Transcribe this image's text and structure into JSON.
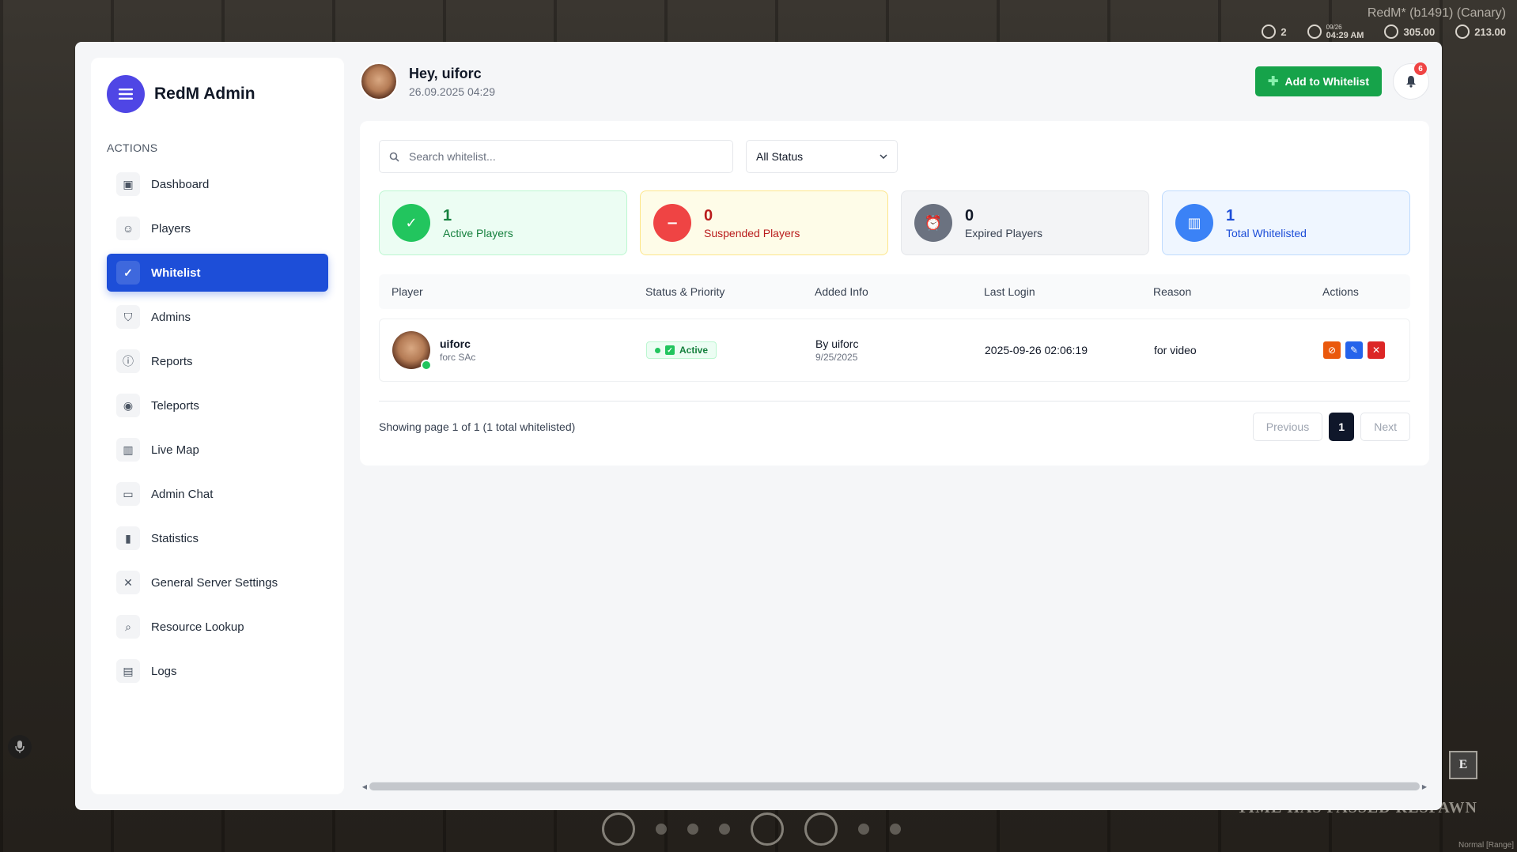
{
  "game_hud": {
    "build": "RedM* (b1491) (Canary)",
    "stats": [
      {
        "icon": "horse-icon",
        "value": "2"
      },
      {
        "icon": "clock-icon",
        "date": "09/26",
        "value": "04:29 AM"
      },
      {
        "icon": "dollar-icon",
        "value": "305.00"
      },
      {
        "icon": "gold-icon",
        "value": "213.00"
      }
    ],
    "respawn_text": "TIME HAS PASSED RESPAWN",
    "key_hint": "E",
    "mode": "Normal [Range]"
  },
  "sidebar": {
    "brand": "RedM Admin",
    "section_label": "ACTIONS",
    "items": [
      {
        "label": "Dashboard",
        "icon": "dashboard-icon",
        "active": false
      },
      {
        "label": "Players",
        "icon": "players-icon",
        "active": false
      },
      {
        "label": "Whitelist",
        "icon": "check-circle-icon",
        "active": true
      },
      {
        "label": "Admins",
        "icon": "shield-icon",
        "active": false
      },
      {
        "label": "Reports",
        "icon": "alert-circle-icon",
        "active": false
      },
      {
        "label": "Teleports",
        "icon": "map-pin-icon",
        "active": false
      },
      {
        "label": "Live Map",
        "icon": "map-icon",
        "active": false
      },
      {
        "label": "Admin Chat",
        "icon": "chat-icon",
        "active": false
      },
      {
        "label": "Statistics",
        "icon": "bar-chart-icon",
        "active": false
      },
      {
        "label": "General Server Settings",
        "icon": "tools-icon",
        "active": false
      },
      {
        "label": "Resource Lookup",
        "icon": "search-icon",
        "active": false
      },
      {
        "label": "Logs",
        "icon": "logs-icon",
        "active": false
      }
    ]
  },
  "header": {
    "greeting": "Hey, uiforc",
    "datetime": "26.09.2025 04:29",
    "add_button": "Add to Whitelist",
    "notifications_count": "6"
  },
  "filters": {
    "search_placeholder": "Search whitelist...",
    "status_selected": "All Status"
  },
  "stats": [
    {
      "value": "1",
      "label": "Active Players"
    },
    {
      "value": "0",
      "label": "Suspended Players"
    },
    {
      "value": "0",
      "label": "Expired Players"
    },
    {
      "value": "1",
      "label": "Total Whitelisted"
    }
  ],
  "table": {
    "columns": [
      "Player",
      "Status & Priority",
      "Added Info",
      "Last Login",
      "Reason",
      "Actions"
    ],
    "rows": [
      {
        "name": "uiforc",
        "sub": "forc SAc",
        "status": "Active",
        "added_by": "By uiforc",
        "added_date": "9/25/2025",
        "last_login": "2025-09-26 02:06:19",
        "reason": "for video"
      }
    ]
  },
  "pagination": {
    "info": "Showing page 1 of 1 (1 total whitelisted)",
    "previous": "Previous",
    "current": "1",
    "next": "Next"
  },
  "colors": {
    "primary": "#1d4ed8",
    "brand": "#4f46e5",
    "success": "#16a34a",
    "danger": "#dc2626",
    "warning": "#ea580c"
  }
}
